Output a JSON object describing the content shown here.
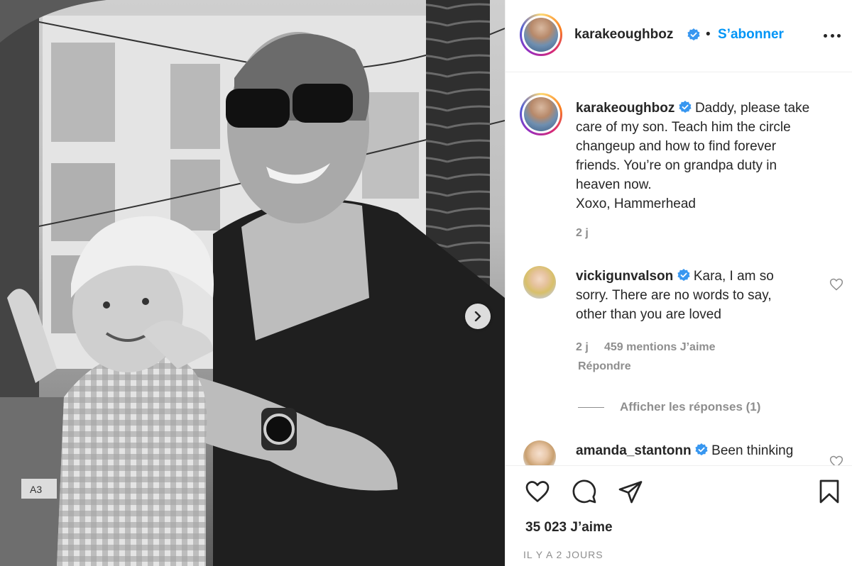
{
  "post": {
    "author": "karakeoughboz",
    "separator": "•",
    "follow_label": "S’abonner",
    "more_icon": "more-options-icon",
    "caption_lines": [
      "Daddy, please take",
      "care of my son. Teach him the circle",
      "changeup and how to find forever",
      "friends. You’re on grandpa duty in",
      "heaven now.",
      "Xoxo, Hammerhead"
    ],
    "caption_age": "2 j"
  },
  "comments": [
    {
      "username": "vickigunvalson",
      "lines": [
        "Kara, I am so",
        "sorry. There are no words to say,",
        "other than you are loved"
      ],
      "age": "2 j",
      "likes": "459 mentions J’aime",
      "reply_label": "Répondre",
      "view_replies": "Afficher les réponses (1)"
    },
    {
      "username": "amanda_stantonn",
      "lines": [
        "Been thinking"
      ]
    }
  ],
  "actions": {
    "like_count": "35 023 J’aime",
    "timestamp": "IL Y A 2 JOURS"
  },
  "colors": {
    "accent": "#0095f6",
    "text": "#262626",
    "muted": "#8e8e8e",
    "border": "#efefef"
  }
}
